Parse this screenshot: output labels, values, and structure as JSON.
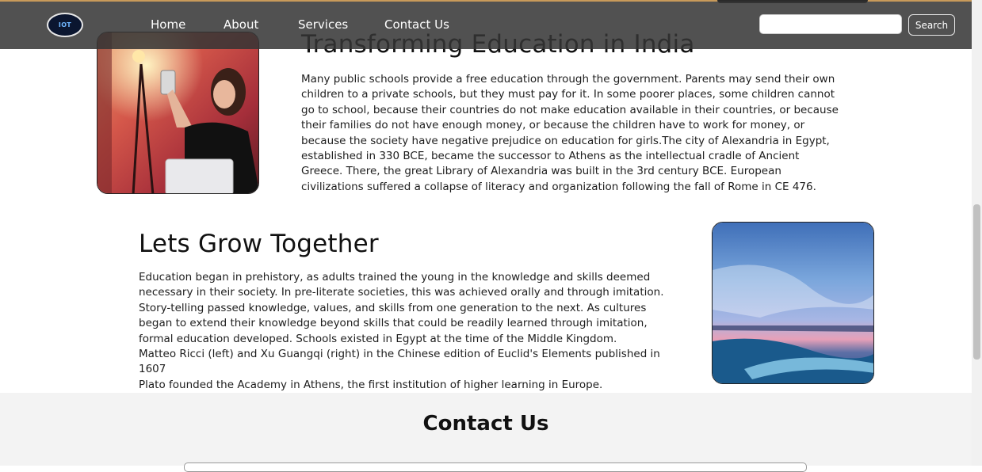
{
  "navbar": {
    "logo_text": "IOT",
    "links": [
      "Home",
      "About",
      "Services",
      "Contact Us"
    ],
    "search": {
      "value": "",
      "placeholder": "",
      "button_label": "Search"
    }
  },
  "section1": {
    "title": "Transforming Education in India",
    "paragraph": "Many public schools provide a free education through the government. Parents may send their own children to a private schools, but they must pay for it. In some poorer places, some children cannot go to school, because their countries do not make education available in their countries, or because their families do not have enough money, or because the children have to work for money, or because the society have negative prejudice on education for girls.The city of Alexandria in Egypt, established in 330 BCE, became the successor to Athens as the intellectual cradle of Ancient Greece. There, the great Library of Alexandria was built in the 3rd century BCE. European civilizations suffered a collapse of literacy and organization following the fall of Rome in CE 476."
  },
  "section2": {
    "title": "Lets Grow Together",
    "paragraphs": [
      "Education began in prehistory, as adults trained the young in the knowledge and skills deemed necessary in their society. In pre-literate societies, this was achieved orally and through imitation. Story-telling passed knowledge, values, and skills from one generation to the next. As cultures began to extend their knowledge beyond skills that could be readily learned through imitation, formal education developed. Schools existed in Egypt at the time of the Middle Kingdom.",
      "Matteo Ricci (left) and Xu Guangqi (right) in the Chinese edition of Euclid's Elements published in 1607",
      "Plato founded the Academy in Athens, the first institution of higher learning in Europe."
    ]
  },
  "contact": {
    "title": "Contact Us"
  },
  "colors": {
    "navbar_bg": "#343434",
    "page_bg": "#ffffff",
    "contact_bg": "#f3f3f3",
    "text": "#1d1d1d"
  }
}
